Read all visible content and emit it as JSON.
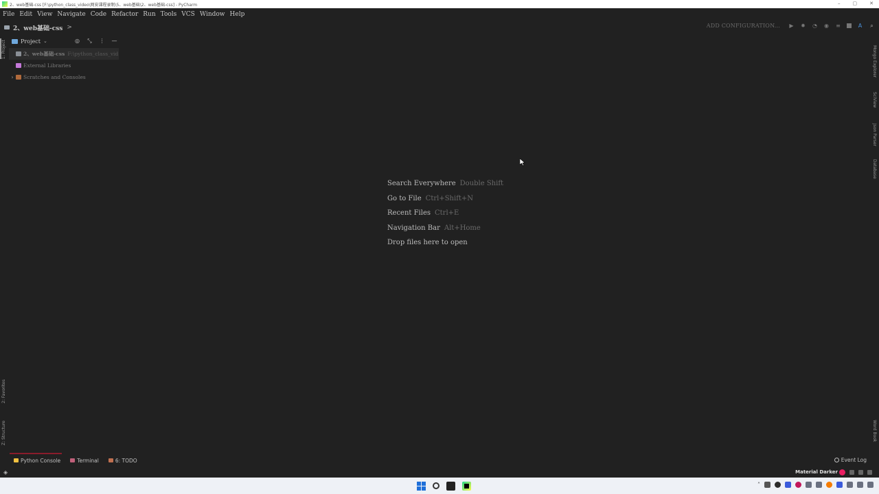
{
  "window": {
    "title": "2、web基础-css [F:\\python_class_video\\网安课程录制\\5、web基础\\2、web基础-css] - PyCharm",
    "controls": [
      "–",
      "▢",
      "✕"
    ]
  },
  "menu": [
    "File",
    "Edit",
    "View",
    "Navigate",
    "Code",
    "Refactor",
    "Run",
    "Tools",
    "VCS",
    "Window",
    "Help"
  ],
  "navbar": {
    "breadcrumb": "2、web基础-css",
    "chevron": ">",
    "add_configuration": "ADD CONFIGURATION..."
  },
  "left_stripe": {
    "project_tab": "1: Project",
    "favorites_tab": "2: Favorites",
    "structure_tab": "Z: Structure"
  },
  "right_stripe": {
    "mongo_tab": "Mongo Explorer",
    "sciview_tab": "SciView",
    "json_tab": "Json Parser",
    "database_tab": "Database",
    "wordbook_tab": "Word Book"
  },
  "project_panel": {
    "title": "Project",
    "tree": [
      {
        "name": "2、web基础-css",
        "path": "F:\\python_class_vid",
        "arrow": "",
        "icon_color": "#8a8f96",
        "selected": true
      },
      {
        "name": "External Libraries",
        "path": "",
        "arrow": "",
        "icon_color": "#c478d8",
        "selected": false
      },
      {
        "name": "Scratches and Consoles",
        "path": "",
        "arrow": "›",
        "icon_color": "#b06a3c",
        "selected": false
      }
    ]
  },
  "editor_hints": [
    {
      "label": "Search Everywhere",
      "key": "Double Shift"
    },
    {
      "label": "Go to File",
      "key": "Ctrl+Shift+N"
    },
    {
      "label": "Recent Files",
      "key": "Ctrl+E"
    },
    {
      "label": "Navigation Bar",
      "key": "Alt+Home"
    },
    {
      "label": "Drop files here to open",
      "key": ""
    }
  ],
  "bottom_tabs": [
    {
      "label": "Python Console",
      "icon_color": "#f0c040"
    },
    {
      "label": "Terminal",
      "icon_color": "#c0607a"
    },
    {
      "label": "6: TODO",
      "icon_color": "#c07050"
    }
  ],
  "event_log": "Event Log",
  "status": {
    "theme": "Material Darker"
  },
  "colors": {
    "background": "#212121",
    "theme_accent": "#e91e63"
  }
}
